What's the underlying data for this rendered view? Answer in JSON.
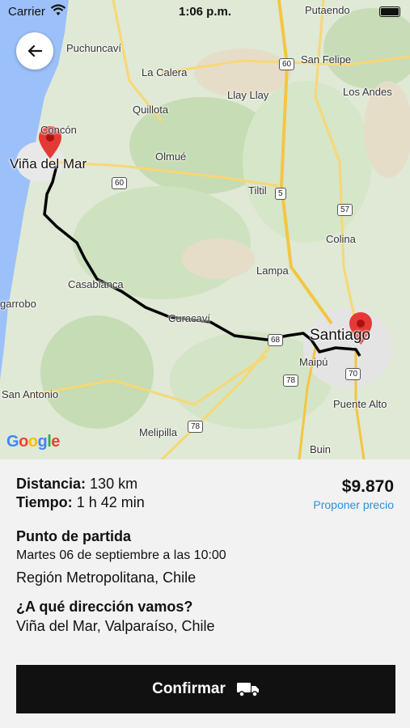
{
  "status_bar": {
    "carrier": "Carrier",
    "time": "1:06 p.m."
  },
  "map": {
    "labels": {
      "puchuncavi": "Puchuncaví",
      "putaendo": "Putaendo",
      "la_calera": "La Calera",
      "san_felipe": "San Felipe",
      "llay_llay": "Llay Llay",
      "los_andes": "Los Andes",
      "quillota": "Quillota",
      "concon": "Concón",
      "vina_del_mar": "Viña del Mar",
      "olmue": "Olmué",
      "tiltil": "Tiltil",
      "colina": "Colina",
      "lampa": "Lampa",
      "casablanca": "Casablanca",
      "algarrobo": "garrobo",
      "curacavi": "Curacaví",
      "santiago": "Santiago",
      "maipu": "Maipú",
      "san_antonio": "San Antonio",
      "puente_alto": "Puente Alto",
      "melipilla": "Melipilla",
      "buin": "Buin"
    },
    "shields": [
      "60",
      "60",
      "5",
      "57",
      "68",
      "78",
      "70",
      "78"
    ],
    "google": {
      "g1": "G",
      "o1": "o",
      "o2": "o",
      "g2": "g",
      "l": "l",
      "e": "e"
    }
  },
  "trip": {
    "distance_label": "Distancia:",
    "distance_value": "130 km",
    "time_label": "Tiempo:",
    "time_value": "1 h 42 min",
    "price": "$9.870",
    "propose_price": "Proponer precio",
    "origin_title": "Punto de partida",
    "origin_datetime": "Martes 06 de septiembre a las 10:00",
    "origin_value": "Región Metropolitana, Chile",
    "destination_title": "¿A qué dirección vamos?",
    "destination_value": "Viña del Mar, Valparaíso, Chile"
  },
  "actions": {
    "confirm_label": "Confirmar"
  },
  "colors": {
    "accent": "#2f8fd6",
    "button": "#111111",
    "route": "#000000",
    "pin": "#e53935"
  }
}
